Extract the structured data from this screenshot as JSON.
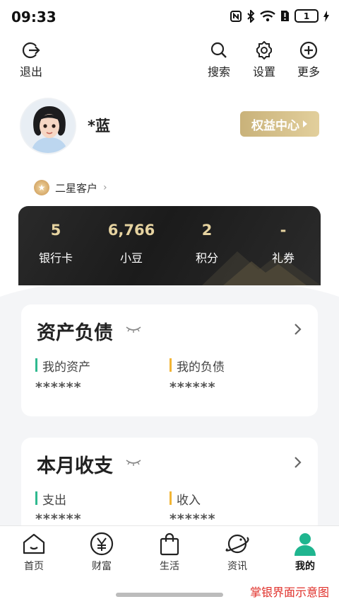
{
  "status_bar": {
    "time": "09:33",
    "battery": "1",
    "icons": [
      "nfc-icon",
      "bluetooth-icon",
      "wifi-icon",
      "sim-alert-icon",
      "battery-icon",
      "charging-icon"
    ]
  },
  "header": {
    "logout_label": "退出",
    "search_label": "搜索",
    "settings_label": "设置",
    "more_label": "更多"
  },
  "profile": {
    "name": "*蓝",
    "rights_button": "权益中心",
    "level_label": "二星客户"
  },
  "stats": [
    {
      "value": "5",
      "label": "银行卡"
    },
    {
      "value": "6,766",
      "label": "小豆"
    },
    {
      "value": "2",
      "label": "积分"
    },
    {
      "value": "-",
      "label": "礼券"
    }
  ],
  "assets_card": {
    "title": "资产负债",
    "left_label": "我的资产",
    "left_value": "******",
    "right_label": "我的负债",
    "right_value": "******"
  },
  "monthly_card": {
    "title": "本月收支",
    "left_label": "支出",
    "left_value": "******",
    "right_label": "收入",
    "right_value": "******"
  },
  "colors": {
    "accent_green": "#1fb58f",
    "gold": "#e6d3a0",
    "watermark_red": "#e0302a",
    "bar_green": "#2fb98f",
    "bar_yellow": "#f2b535"
  },
  "tabs": [
    {
      "label": "首页",
      "icon": "home-icon"
    },
    {
      "label": "财富",
      "icon": "yuan-icon"
    },
    {
      "label": "生活",
      "icon": "shopping-bag-icon"
    },
    {
      "label": "资讯",
      "icon": "planet-icon"
    },
    {
      "label": "我的",
      "icon": "profile-icon"
    }
  ],
  "watermark": "掌银界面示意图"
}
